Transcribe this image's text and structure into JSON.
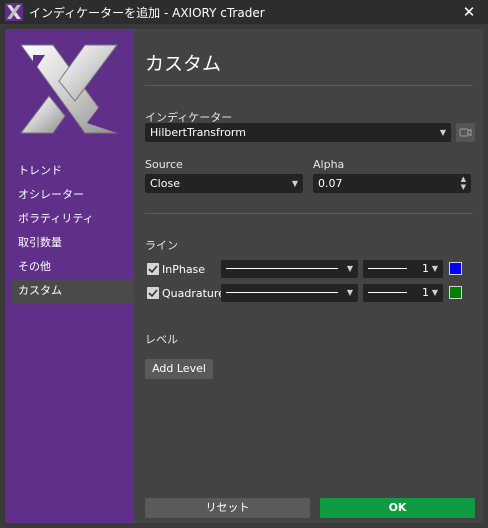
{
  "window": {
    "title": "インディケーターを追加 - AXIORY cTrader",
    "close_glyph": "✕"
  },
  "sidebar": {
    "items": [
      {
        "label": "トレンド",
        "active": false
      },
      {
        "label": "オシレーター",
        "active": false
      },
      {
        "label": "ボラティリティ",
        "active": false
      },
      {
        "label": "取引数量",
        "active": false
      },
      {
        "label": "その他",
        "active": false
      },
      {
        "label": "カスタム",
        "active": true
      }
    ]
  },
  "main": {
    "title": "カスタム",
    "indicator_label": "インディケーター",
    "indicator_value": "HilbertTransfrorm",
    "source_label": "Source",
    "source_value": "Close",
    "alpha_label": "Alpha",
    "alpha_value": "0.07",
    "lines_label": "ライン",
    "lines": [
      {
        "name": "InPhase",
        "checked": true,
        "width": "1",
        "color": "#0000ff"
      },
      {
        "name": "Quadrature",
        "checked": true,
        "width": "1",
        "color": "#008000"
      }
    ],
    "levels_label": "レベル",
    "add_level_label": "Add Level"
  },
  "footer": {
    "reset_label": "リセット",
    "ok_label": "OK"
  },
  "colors": {
    "sidebar_bg": "#5f2f8a",
    "ok_green": "#0f9b43"
  },
  "icons": {
    "app": "ctrader-x-logo-icon",
    "close": "close-icon",
    "caret": "chevron-down-icon",
    "preview": "video-camera-icon"
  }
}
